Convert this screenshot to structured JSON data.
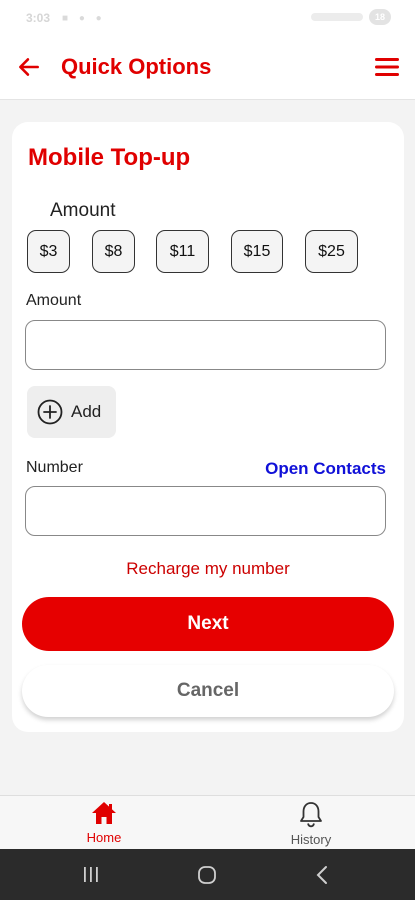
{
  "status_bar": {
    "time": "3:03",
    "battery": "18"
  },
  "header": {
    "title": "Quick Options",
    "back_icon": "arrow-left-icon",
    "menu_icon": "hamburger-menu-icon"
  },
  "card": {
    "title": "Mobile Top-up",
    "amount_heading": "Amount",
    "amount_chips": [
      "$3",
      "$8",
      "$11",
      "$15",
      "$25"
    ],
    "amount_label": "Amount",
    "amount_value": "",
    "add_label": "Add",
    "number_label": "Number",
    "number_value": "",
    "open_contacts": "Open Contacts",
    "recharge_link": "Recharge my number",
    "next_label": "Next",
    "cancel_label": "Cancel"
  },
  "bottom_nav": {
    "items": [
      {
        "label": "Home",
        "icon": "home-icon",
        "active": true
      },
      {
        "label": "History",
        "icon": "bell-icon",
        "active": false
      }
    ]
  },
  "colors": {
    "brand_red": "#e60000",
    "link_blue": "#1010d8",
    "recharge_red": "#cc0000"
  }
}
